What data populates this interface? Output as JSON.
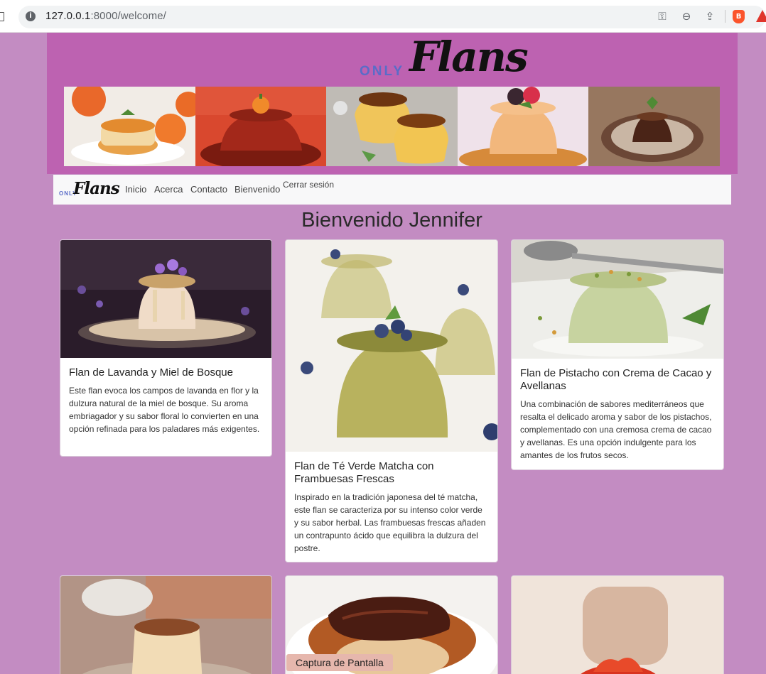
{
  "browser": {
    "url_host": "127.0.0.1",
    "url_path": ":8000/welcome/",
    "icons": [
      "info-icon",
      "key-icon",
      "zoom-out-icon",
      "share-icon",
      "brave-icon",
      "brave-rewards-icon"
    ]
  },
  "header": {
    "logo_only": "ONLY",
    "logo_flans": "Flans",
    "banner_images": [
      "flan-orange",
      "flan-pumpkin",
      "flan-caramel-orange",
      "flan-berries",
      "flan-chocolate"
    ]
  },
  "nav": {
    "brand_only": "ONLY",
    "brand_flans": "Flans",
    "links": [
      "Inicio",
      "Acerca",
      "Contacto",
      "Bienvenido",
      "Cerrar sesión"
    ]
  },
  "main": {
    "welcome": "Bienvenido Jennifer",
    "cards": [
      {
        "title": "Flan de Lavanda y Miel de Bosque",
        "text": "Este flan evoca los campos de lavanda en flor y la dulzura natural de la miel de bosque. Su aroma embriagador y su sabor floral lo convierten en una opción refinada para los paladares más exigentes."
      },
      {
        "title": "Flan de Té Verde Matcha con Frambuesas Frescas",
        "text": "Inspirado en la tradición japonesa del té matcha, este flan se caracteriza por su intenso color verde y su sabor herbal. Las frambuesas frescas añaden un contrapunto ácido que equilibra la dulzura del postre."
      },
      {
        "title": "Flan de Pistacho con Crema de Cacao y Avellanas",
        "text": "Una combinación de sabores mediterráneos que resalta el delicado aroma y sabor de los pistachos, complementado con una cremosa crema de cacao y avellanas. Es una opción indulgente para los amantes de los frutos secos."
      }
    ]
  },
  "tooltip": "Captura de Pantalla",
  "colors": {
    "page_bg": "#c38cc2",
    "banner_bg": "#bd62b1",
    "logo_blue": "#5a6cc8"
  }
}
